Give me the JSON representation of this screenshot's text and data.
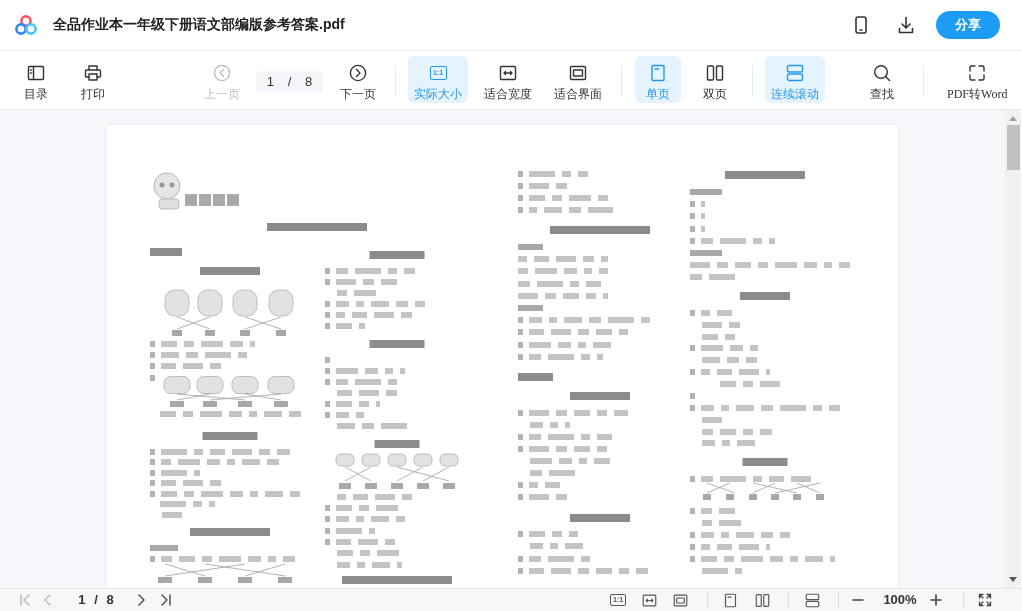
{
  "window": {
    "title": "全品作业本一年级下册语文部编版参考答案.pdf"
  },
  "header": {
    "share_button": "分享"
  },
  "toolbar": {
    "file": [
      {
        "kind": "contents",
        "label": "目录"
      },
      {
        "kind": "print",
        "label": "打印"
      }
    ],
    "navigation": {
      "previous": {
        "label": "上一页",
        "disabled": true
      },
      "page_field": {
        "value": "1 / 8"
      },
      "next": {
        "label": "下一页",
        "disabled": false
      }
    },
    "zoom_modes": [
      {
        "kind": "actual_size",
        "label": "实际大小",
        "icon_text": "1:1",
        "selected": true
      },
      {
        "kind": "fit_width",
        "label": "适合宽度",
        "selected": false
      },
      {
        "kind": "fit_page",
        "label": "适合界面",
        "selected": false
      }
    ],
    "page_modes": [
      {
        "kind": "single",
        "label": "单页",
        "selected": true
      },
      {
        "kind": "double",
        "label": "双页",
        "selected": false
      }
    ],
    "scroll_mode": {
      "label": "连续滚动",
      "on": true
    },
    "tools": [
      {
        "kind": "search",
        "label": "查找"
      },
      {
        "kind": "convert",
        "label": "PDF转Word"
      }
    ]
  },
  "status_bar": {
    "first_page": {
      "disabled": true
    },
    "previous_page": {
      "disabled": true
    },
    "page_indicator": "1 / 8",
    "next_page": {
      "disabled": false
    },
    "last_page": {
      "disabled": false
    },
    "view_buttons": [
      {
        "kind": "actual_size",
        "icon_text": "1:1"
      },
      {
        "kind": "fit_width"
      },
      {
        "kind": "fit_page"
      },
      {
        "kind": "single"
      },
      {
        "kind": "double"
      },
      {
        "kind": "continuous"
      }
    ],
    "zoom": "100%"
  }
}
